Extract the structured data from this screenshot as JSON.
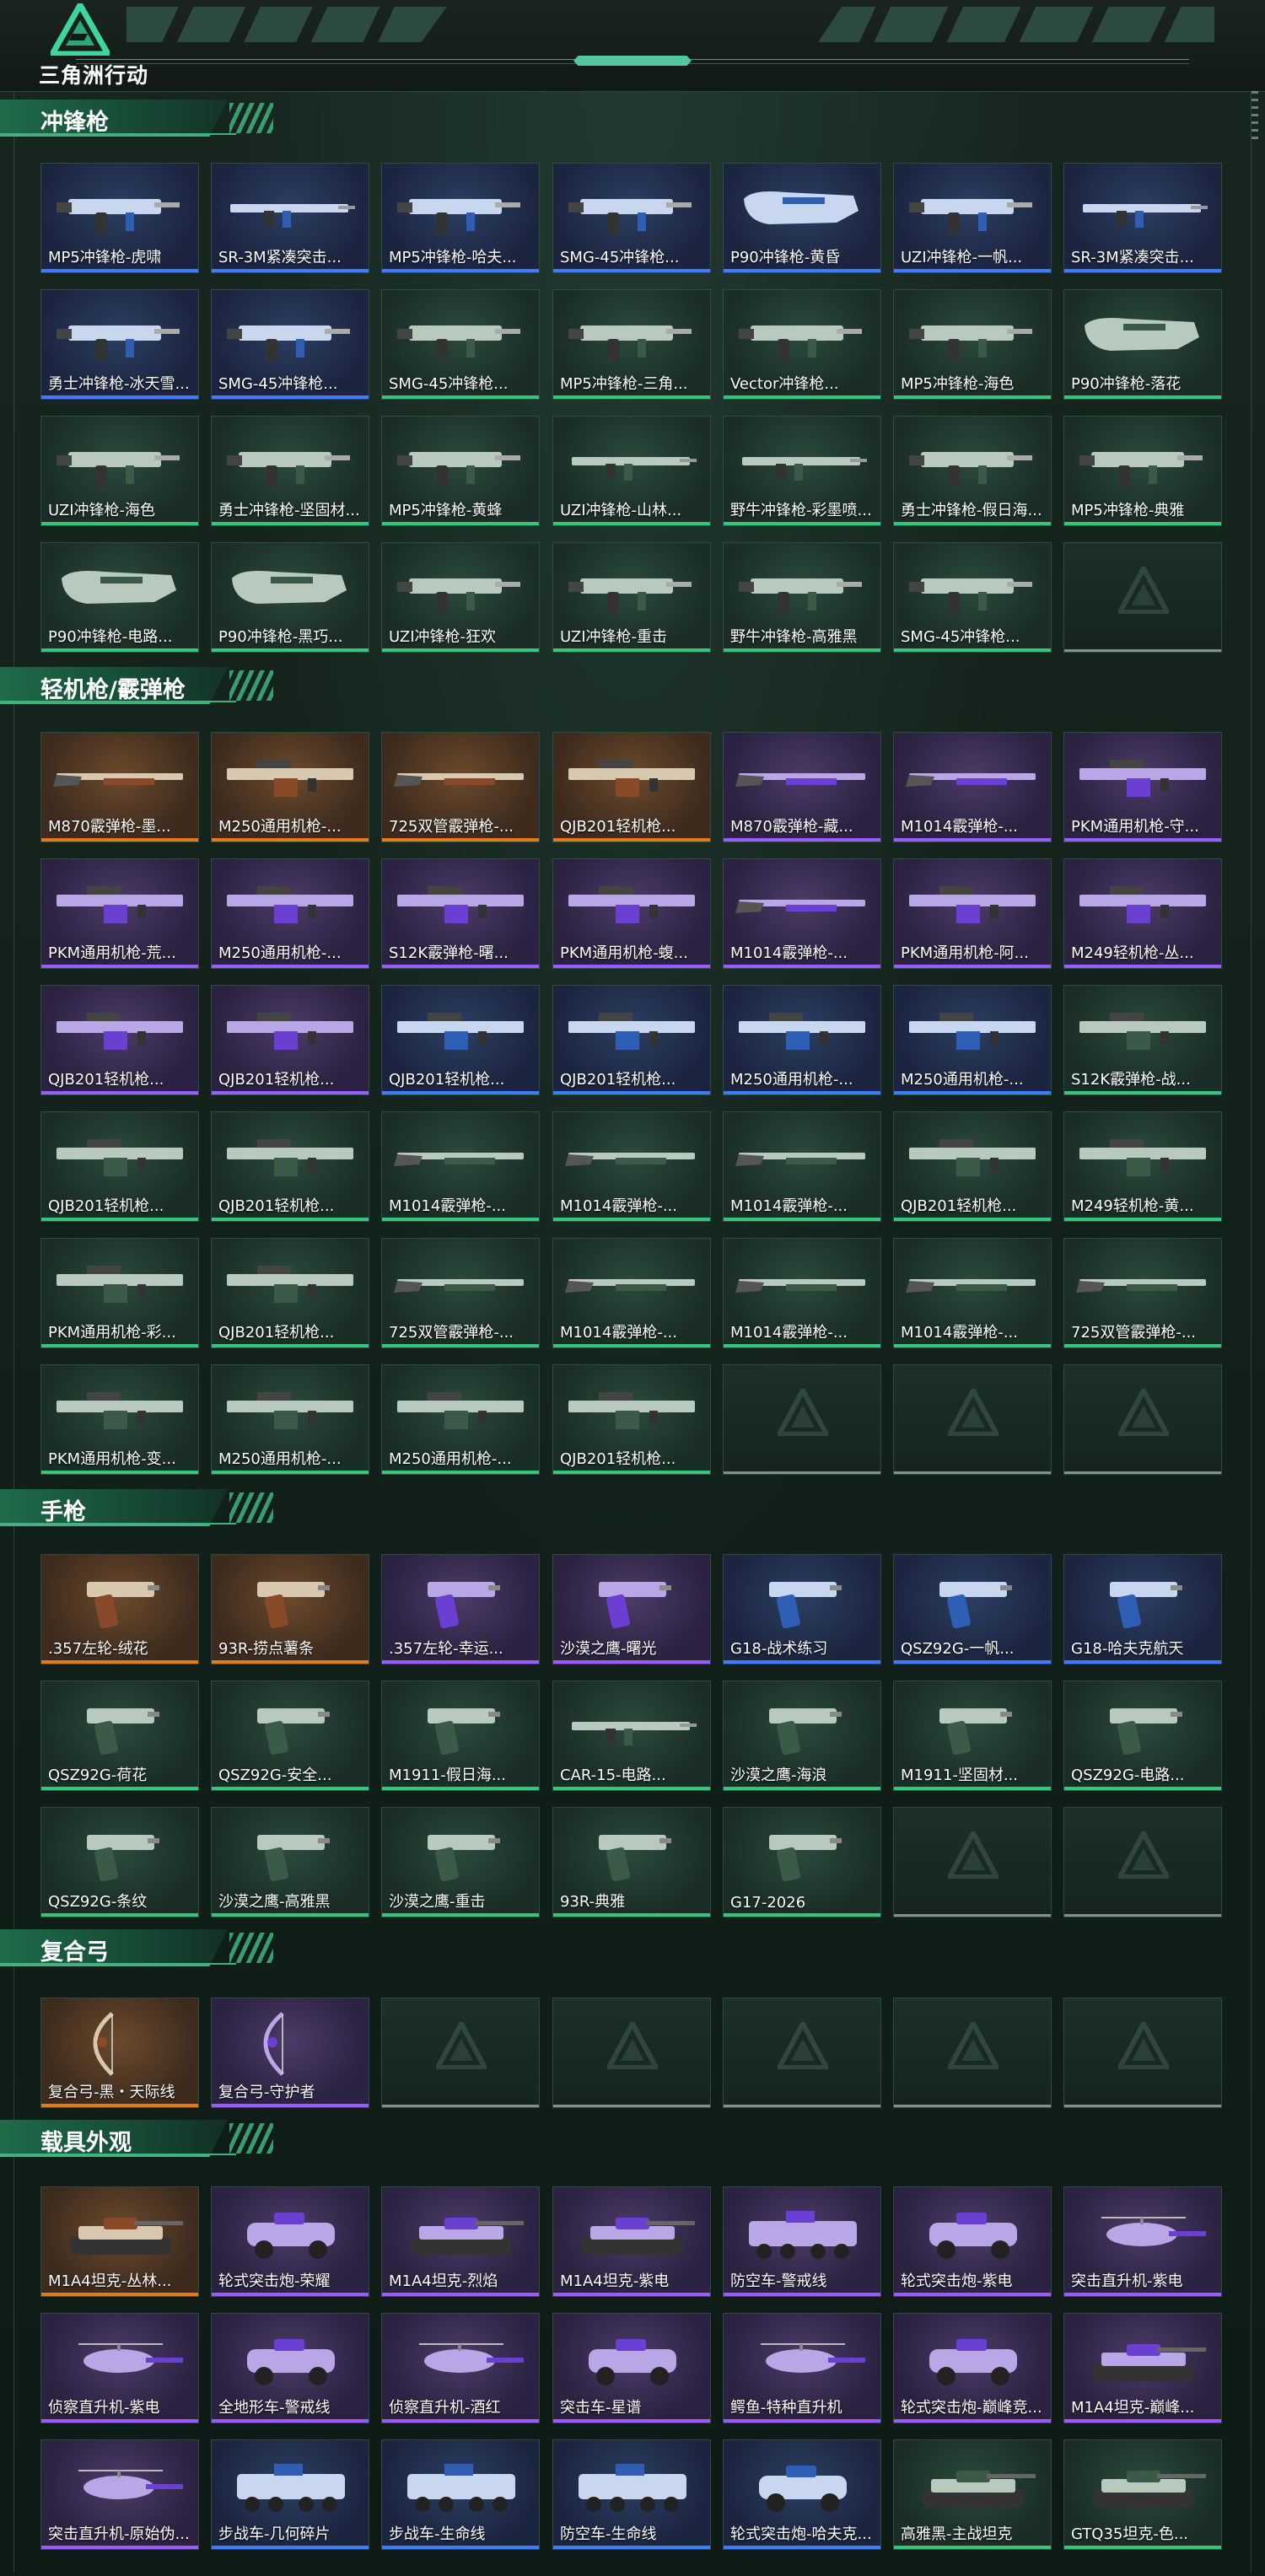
{
  "app": {
    "logo_text": "三角洲行动",
    "logo_icon": "delta-triangle-icon"
  },
  "colors": {
    "gold": "#e37a1e",
    "purple": "#9a5cff",
    "blue": "#3e7bff",
    "green": "#34c77b",
    "accent": "#3fb27f"
  },
  "sections": [
    {
      "id": "smg",
      "title": "冲锋枪",
      "items": [
        {
          "name": "MP5冲锋枪-虎啸",
          "rarity": "blue",
          "kind": "smg"
        },
        {
          "name": "SR-3M紧凑突击...",
          "rarity": "blue",
          "kind": "rifle"
        },
        {
          "name": "MP5冲锋枪-哈夫...",
          "rarity": "blue",
          "kind": "smg"
        },
        {
          "name": "SMG-45冲锋枪...",
          "rarity": "blue",
          "kind": "smg"
        },
        {
          "name": "P90冲锋枪-黄昏",
          "rarity": "blue",
          "kind": "p90"
        },
        {
          "name": "UZI冲锋枪-一帆...",
          "rarity": "blue",
          "kind": "smg"
        },
        {
          "name": "SR-3M紧凑突击...",
          "rarity": "blue",
          "kind": "rifle"
        },
        {
          "name": "勇士冲锋枪-冰天雪...",
          "rarity": "blue",
          "kind": "smg"
        },
        {
          "name": "SMG-45冲锋枪...",
          "rarity": "blue",
          "kind": "smg"
        },
        {
          "name": "SMG-45冲锋枪...",
          "rarity": "green",
          "kind": "smg"
        },
        {
          "name": "MP5冲锋枪-三角...",
          "rarity": "green",
          "kind": "smg"
        },
        {
          "name": "Vector冲锋枪...",
          "rarity": "green",
          "kind": "smg"
        },
        {
          "name": "MP5冲锋枪-海色",
          "rarity": "green",
          "kind": "smg"
        },
        {
          "name": "P90冲锋枪-落花",
          "rarity": "green",
          "kind": "p90"
        },
        {
          "name": "UZI冲锋枪-海色",
          "rarity": "green",
          "kind": "smg"
        },
        {
          "name": "勇士冲锋枪-坚固材...",
          "rarity": "green",
          "kind": "smg"
        },
        {
          "name": "MP5冲锋枪-黄蜂",
          "rarity": "green",
          "kind": "smg"
        },
        {
          "name": "UZI冲锋枪-山林...",
          "rarity": "green",
          "kind": "rifle"
        },
        {
          "name": "野牛冲锋枪-彩墨喷...",
          "rarity": "green",
          "kind": "rifle"
        },
        {
          "name": "勇士冲锋枪-假日海...",
          "rarity": "green",
          "kind": "smg"
        },
        {
          "name": "MP5冲锋枪-典雅",
          "rarity": "green",
          "kind": "smg"
        },
        {
          "name": "P90冲锋枪-电路...",
          "rarity": "green",
          "kind": "p90"
        },
        {
          "name": "P90冲锋枪-黑巧...",
          "rarity": "green",
          "kind": "p90"
        },
        {
          "name": "UZI冲锋枪-狂欢",
          "rarity": "green",
          "kind": "smg"
        },
        {
          "name": "UZI冲锋枪-重击",
          "rarity": "green",
          "kind": "smg"
        },
        {
          "name": "野牛冲锋枪-高雅黑",
          "rarity": "green",
          "kind": "smg"
        },
        {
          "name": "SMG-45冲锋枪...",
          "rarity": "green",
          "kind": "smg"
        },
        {
          "name": "",
          "rarity": "empty",
          "kind": "none"
        }
      ]
    },
    {
      "id": "lmg",
      "title": "轻机枪/霰弹枪",
      "items": [
        {
          "name": "M870霰弹枪-墨...",
          "rarity": "gold",
          "kind": "shotgun"
        },
        {
          "name": "M250通用机枪-...",
          "rarity": "gold",
          "kind": "lmg"
        },
        {
          "name": "725双管霰弹枪-...",
          "rarity": "gold",
          "kind": "shotgun"
        },
        {
          "name": "QJB201轻机枪...",
          "rarity": "gold",
          "kind": "lmg"
        },
        {
          "name": "M870霰弹枪-藏...",
          "rarity": "purple",
          "kind": "shotgun"
        },
        {
          "name": "M1014霰弹枪-...",
          "rarity": "purple",
          "kind": "shotgun"
        },
        {
          "name": "PKM通用机枪-守...",
          "rarity": "purple",
          "kind": "lmg"
        },
        {
          "name": "PKM通用机枪-荒...",
          "rarity": "purple",
          "kind": "lmg"
        },
        {
          "name": "M250通用机枪-...",
          "rarity": "purple",
          "kind": "lmg"
        },
        {
          "name": "S12K霰弹枪-曙...",
          "rarity": "purple",
          "kind": "lmg"
        },
        {
          "name": "PKM通用机枪-蝮...",
          "rarity": "purple",
          "kind": "lmg"
        },
        {
          "name": "M1014霰弹枪-...",
          "rarity": "purple",
          "kind": "shotgun"
        },
        {
          "name": "PKM通用机枪-阿...",
          "rarity": "purple",
          "kind": "lmg"
        },
        {
          "name": "M249轻机枪-丛...",
          "rarity": "purple",
          "kind": "lmg"
        },
        {
          "name": "QJB201轻机枪...",
          "rarity": "purple",
          "kind": "lmg"
        },
        {
          "name": "QJB201轻机枪...",
          "rarity": "purple",
          "kind": "lmg"
        },
        {
          "name": "QJB201轻机枪...",
          "rarity": "blue",
          "kind": "lmg"
        },
        {
          "name": "QJB201轻机枪...",
          "rarity": "blue",
          "kind": "lmg"
        },
        {
          "name": "M250通用机枪-...",
          "rarity": "blue",
          "kind": "lmg"
        },
        {
          "name": "M250通用机枪-...",
          "rarity": "blue",
          "kind": "lmg"
        },
        {
          "name": "S12K霰弹枪-战...",
          "rarity": "green",
          "kind": "lmg"
        },
        {
          "name": "QJB201轻机枪...",
          "rarity": "green",
          "kind": "lmg"
        },
        {
          "name": "QJB201轻机枪...",
          "rarity": "green",
          "kind": "lmg"
        },
        {
          "name": "M1014霰弹枪-...",
          "rarity": "green",
          "kind": "shotgun"
        },
        {
          "name": "M1014霰弹枪-...",
          "rarity": "green",
          "kind": "shotgun"
        },
        {
          "name": "M1014霰弹枪-...",
          "rarity": "green",
          "kind": "shotgun"
        },
        {
          "name": "QJB201轻机枪...",
          "rarity": "green",
          "kind": "lmg"
        },
        {
          "name": "M249轻机枪-黄...",
          "rarity": "green",
          "kind": "lmg"
        },
        {
          "name": "PKM通用机枪-彩...",
          "rarity": "green",
          "kind": "lmg"
        },
        {
          "name": "QJB201轻机枪...",
          "rarity": "green",
          "kind": "lmg"
        },
        {
          "name": "725双管霰弹枪-...",
          "rarity": "green",
          "kind": "shotgun"
        },
        {
          "name": "M1014霰弹枪-...",
          "rarity": "green",
          "kind": "shotgun"
        },
        {
          "name": "M1014霰弹枪-...",
          "rarity": "green",
          "kind": "shotgun"
        },
        {
          "name": "M1014霰弹枪-...",
          "rarity": "green",
          "kind": "shotgun"
        },
        {
          "name": "725双管霰弹枪-...",
          "rarity": "green",
          "kind": "shotgun"
        },
        {
          "name": "PKM通用机枪-变...",
          "rarity": "green",
          "kind": "lmg"
        },
        {
          "name": "M250通用机枪-...",
          "rarity": "green",
          "kind": "lmg"
        },
        {
          "name": "M250通用机枪-...",
          "rarity": "green",
          "kind": "lmg"
        },
        {
          "name": "QJB201轻机枪...",
          "rarity": "green",
          "kind": "lmg"
        },
        {
          "name": "",
          "rarity": "empty",
          "kind": "none"
        },
        {
          "name": "",
          "rarity": "empty",
          "kind": "none"
        },
        {
          "name": "",
          "rarity": "empty",
          "kind": "none"
        }
      ]
    },
    {
      "id": "pistol",
      "title": "手枪",
      "items": [
        {
          "name": ".357左轮-绒花",
          "rarity": "gold",
          "kind": "pistol"
        },
        {
          "name": "93R-捞点薯条",
          "rarity": "gold",
          "kind": "pistol"
        },
        {
          "name": ".357左轮-幸运...",
          "rarity": "purple",
          "kind": "pistol"
        },
        {
          "name": "沙漠之鹰-曙光",
          "rarity": "purple",
          "kind": "pistol"
        },
        {
          "name": "G18-战术练习",
          "rarity": "blue",
          "kind": "pistol"
        },
        {
          "name": "QSZ92G-一帆...",
          "rarity": "blue",
          "kind": "pistol"
        },
        {
          "name": "G18-哈夫克航天",
          "rarity": "blue",
          "kind": "pistol"
        },
        {
          "name": "QSZ92G-荷花",
          "rarity": "green",
          "kind": "pistol"
        },
        {
          "name": "QSZ92G-安全...",
          "rarity": "green",
          "kind": "pistol"
        },
        {
          "name": "M1911-假日海...",
          "rarity": "green",
          "kind": "pistol"
        },
        {
          "name": "CAR-15-电路...",
          "rarity": "green",
          "kind": "rifle"
        },
        {
          "name": "沙漠之鹰-海浪",
          "rarity": "green",
          "kind": "pistol"
        },
        {
          "name": "M1911-坚固材...",
          "rarity": "green",
          "kind": "pistol"
        },
        {
          "name": "QSZ92G-电路...",
          "rarity": "green",
          "kind": "pistol"
        },
        {
          "name": "QSZ92G-条纹",
          "rarity": "green",
          "kind": "pistol"
        },
        {
          "name": "沙漠之鹰-高雅黑",
          "rarity": "green",
          "kind": "pistol"
        },
        {
          "name": "沙漠之鹰-重击",
          "rarity": "green",
          "kind": "pistol"
        },
        {
          "name": "93R-典雅",
          "rarity": "green",
          "kind": "pistol"
        },
        {
          "name": "G17-2026",
          "rarity": "green",
          "kind": "pistol"
        },
        {
          "name": "",
          "rarity": "empty",
          "kind": "none"
        },
        {
          "name": "",
          "rarity": "empty",
          "kind": "none"
        }
      ]
    },
    {
      "id": "bow",
      "title": "复合弓",
      "items": [
        {
          "name": "复合弓-黑・天际线",
          "rarity": "gold",
          "kind": "bow"
        },
        {
          "name": "复合弓-守护者",
          "rarity": "purple",
          "kind": "bow"
        },
        {
          "name": "",
          "rarity": "empty",
          "kind": "none"
        },
        {
          "name": "",
          "rarity": "empty",
          "kind": "none"
        },
        {
          "name": "",
          "rarity": "empty",
          "kind": "none"
        },
        {
          "name": "",
          "rarity": "empty",
          "kind": "none"
        },
        {
          "name": "",
          "rarity": "empty",
          "kind": "none"
        }
      ]
    },
    {
      "id": "vehicle",
      "title": "载具外观",
      "items": [
        {
          "name": "M1A4坦克-丛林...",
          "rarity": "gold",
          "kind": "tank"
        },
        {
          "name": "轮式突击炮-荣耀",
          "rarity": "purple",
          "kind": "car"
        },
        {
          "name": "M1A4坦克-烈焰",
          "rarity": "purple",
          "kind": "tank"
        },
        {
          "name": "M1A4坦克-紫电",
          "rarity": "purple",
          "kind": "tank"
        },
        {
          "name": "防空车-警戒线",
          "rarity": "purple",
          "kind": "apc"
        },
        {
          "name": "轮式突击炮-紫电",
          "rarity": "purple",
          "kind": "car"
        },
        {
          "name": "突击直升机-紫电",
          "rarity": "purple",
          "kind": "heli"
        },
        {
          "name": "侦察直升机-紫电",
          "rarity": "purple",
          "kind": "heli"
        },
        {
          "name": "全地形车-警戒线",
          "rarity": "purple",
          "kind": "car"
        },
        {
          "name": "侦察直升机-酒红",
          "rarity": "purple",
          "kind": "heli"
        },
        {
          "name": "突击车-星谱",
          "rarity": "purple",
          "kind": "car"
        },
        {
          "name": "鳄鱼-特种直升机",
          "rarity": "purple",
          "kind": "heli"
        },
        {
          "name": "轮式突击炮-巅峰竞...",
          "rarity": "purple",
          "kind": "car"
        },
        {
          "name": "M1A4坦克-巅峰...",
          "rarity": "purple",
          "kind": "tank"
        },
        {
          "name": "突击直升机-原始伪...",
          "rarity": "purple",
          "kind": "heli"
        },
        {
          "name": "步战车-几何碎片",
          "rarity": "blue",
          "kind": "apc"
        },
        {
          "name": "步战车-生命线",
          "rarity": "blue",
          "kind": "apc"
        },
        {
          "name": "防空车-生命线",
          "rarity": "blue",
          "kind": "apc"
        },
        {
          "name": "轮式突击炮-哈夫克...",
          "rarity": "blue",
          "kind": "car"
        },
        {
          "name": "高雅黑-主战坦克",
          "rarity": "green",
          "kind": "tank"
        },
        {
          "name": "GTQ35坦克-色...",
          "rarity": "green",
          "kind": "tank"
        }
      ]
    }
  ]
}
